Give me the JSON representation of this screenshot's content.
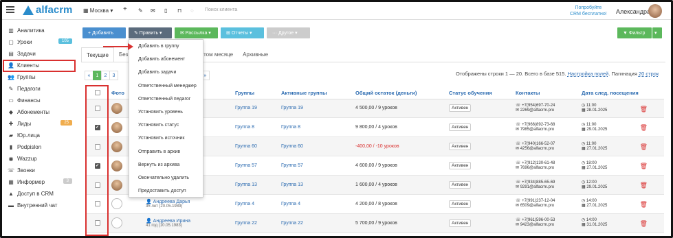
{
  "app": {
    "logo": "alfacrm",
    "city": "Москва",
    "search_placeholder": "Поиск клиента",
    "try_line1": "Попробуйте",
    "try_line2": "CRM бесплатно!",
    "user": "Александра"
  },
  "sidebar": {
    "items": [
      {
        "label": "Аналитика",
        "icon": "chart-icon"
      },
      {
        "label": "Уроки",
        "icon": "calendar-icon",
        "badge": "105",
        "badge_color": "#5bc0de"
      },
      {
        "label": "Задачи",
        "icon": "tasks-icon"
      },
      {
        "label": "Клиенты",
        "icon": "user-icon"
      },
      {
        "label": "Группы",
        "icon": "group-icon"
      },
      {
        "label": "Педагоги",
        "icon": "teacher-icon"
      },
      {
        "label": "Финансы",
        "icon": "money-icon"
      },
      {
        "label": "Абонементы",
        "icon": "tag-icon"
      },
      {
        "label": "Лиды",
        "icon": "lead-icon",
        "badge": "25",
        "badge_color": "#f0ad4e"
      },
      {
        "label": "Юр.лица",
        "icon": "briefcase-icon"
      },
      {
        "label": "Podpislon",
        "icon": "file-icon"
      },
      {
        "label": "Wazzup",
        "icon": "whatsapp-icon"
      },
      {
        "label": "Звонки",
        "icon": "phone-icon"
      },
      {
        "label": "Информер",
        "icon": "bell-icon",
        "badge": "3",
        "badge_color": "#ccc"
      },
      {
        "label": "Доступ в CRM",
        "icon": "lock-icon"
      },
      {
        "label": "Внутренний чат",
        "icon": "chat-icon"
      }
    ]
  },
  "toolbar": {
    "add": "+ Добавить",
    "edit": "✎ Править ▾",
    "mail": "✉ Рассылка ▾",
    "reports": "⊞ Отчеты ▾",
    "other": "··· Другое ▾",
    "filter": "▼ Фильтр",
    "filter_caret": "▾"
  },
  "tabs": [
    {
      "label": "Текущие"
    },
    {
      "label": "Без"
    },
    {
      "label": "этом месяце"
    },
    {
      "label": "Архивные"
    }
  ],
  "pager": {
    "prev": "«",
    "pages": [
      "1",
      "2",
      "3"
    ],
    "next": "»"
  },
  "info": {
    "text": "Отображены строки 1 — 20. Всего в базе 515.",
    "settings": "Настройка полей",
    "pagination": ". Пагинация",
    "per_page": "20 строк"
  },
  "table": {
    "headers": {
      "photo": "Фото",
      "groups": "Группы",
      "active": "Активные группы",
      "balance": "Общий остаток (деньги)",
      "status": "Статус обучения",
      "contacts": "Контакты",
      "next": "Дата след. посещения"
    },
    "rows": [
      {
        "checked": false,
        "has_photo": true,
        "name": "",
        "age": "",
        "group": "Группа 19",
        "active": "Группа 19",
        "balance": "4 500,00 / 9 уроков",
        "neg": false,
        "status": "Активен",
        "phone": "☏ +7(954)697-70-24",
        "email": "✉ 2269@alfacrm.pro",
        "time": "◷ 11:00",
        "date": "▦ 28.01.2025"
      },
      {
        "checked": true,
        "has_photo": true,
        "name": "",
        "age": "",
        "group": "Группа 8",
        "active": "Группа 8",
        "balance": "9 800,00 / 4 уроков",
        "neg": false,
        "status": "Активен",
        "phone": "☏ +7(966)892-73-68",
        "email": "✉ 7985@alfacrm.pro",
        "time": "◷ 11:00",
        "date": "▦ 29.01.2025"
      },
      {
        "checked": false,
        "has_photo": true,
        "name": "",
        "age": "",
        "group": "Группа 60",
        "active": "Группа 60",
        "balance": "-400,00 / -10 уроков",
        "neg": true,
        "status": "Активен",
        "phone": "☏ +7(940)166-52-07",
        "email": "✉ 4256@alfacrm.pro",
        "time": "◷ 11:00",
        "date": "▦ 27.01.2025"
      },
      {
        "checked": true,
        "has_photo": true,
        "name": "",
        "age": "",
        "group": "Группа 57",
        "active": "Группа 57",
        "balance": "4 600,00 / 9 уроков",
        "neg": false,
        "status": "Активен",
        "phone": "☏ +7(912)130-61-48",
        "email": "✉ 7696@alfacrm.pro",
        "time": "◷ 18:00",
        "date": "▦ 27.01.2025"
      },
      {
        "checked": false,
        "has_photo": true,
        "name": "",
        "age": "",
        "group": "Группа 13",
        "active": "Группа 13",
        "balance": "1 600,00 / 4 уроков",
        "neg": false,
        "status": "Активен",
        "phone": "☏ +7(934)885-65-69",
        "email": "✉ 9291@alfacrm.pro",
        "time": "◷ 12:00",
        "date": "▦ 29.01.2025"
      },
      {
        "checked": false,
        "has_photo": false,
        "name": "👤 Андреева Дарья",
        "age": "35 лет (20.05.1989)",
        "group": "Группа 4",
        "active": "Группа 4",
        "balance": "4 200,00 / 8 уроков",
        "neg": false,
        "status": "Активен",
        "phone": "☏ +7(991)237-12-04",
        "email": "✉ 6509@alfacrm.pro",
        "time": "◷ 14:00",
        "date": "▦ 27.01.2025"
      },
      {
        "checked": false,
        "has_photo": false,
        "name": "👤 Андреева Ирина",
        "age": "41 год (10.05.1983)",
        "group": "Группа 22",
        "active": "Группа 22",
        "balance": "5 700,00 / 9 уроков",
        "neg": false,
        "status": "Активен",
        "phone": "☏ +7(961)596-00-53",
        "email": "✉ 9423@alfacrm.pro",
        "time": "◷ 14:00",
        "date": "▦ 31.01.2025"
      }
    ]
  },
  "menu": {
    "items": [
      "Добавить в группу",
      "Добавить абонемент",
      "Добавить задачи",
      "Ответственный менеджер",
      "Ответственный педагог",
      "Установить уровень",
      "Установить статус",
      "Установить источник",
      "Отправить в архив",
      "Вернуть из архива",
      "Окончательно удалить",
      "Предоставить доступ"
    ]
  },
  "colors": {
    "brand": "#2a8ccb",
    "add": "#4a8fcf",
    "edit": "#5b6b7c",
    "mail": "#5cb85c",
    "reports": "#5bc0de",
    "other": "#ccc",
    "filter": "#5cb85c",
    "annotation": "#d9302f"
  }
}
